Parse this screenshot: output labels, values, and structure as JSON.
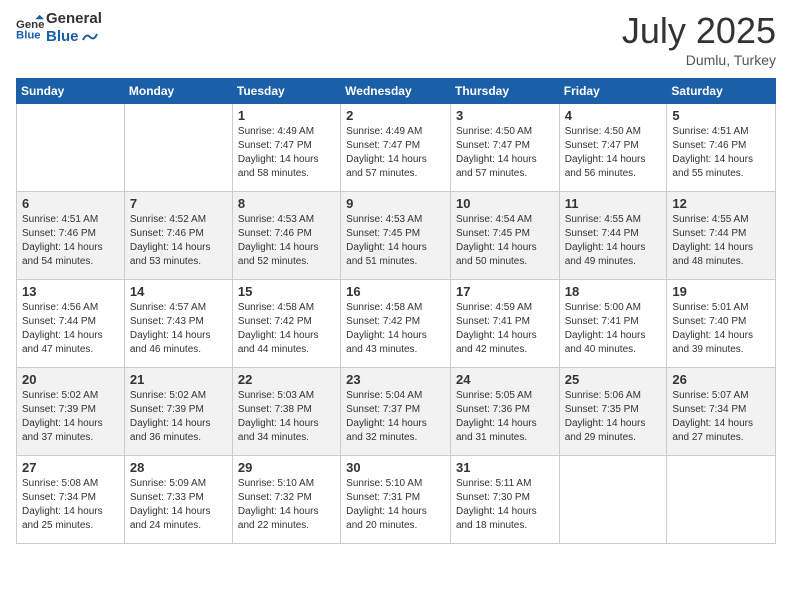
{
  "logo": {
    "text_general": "General",
    "text_blue": "Blue"
  },
  "header": {
    "month": "July 2025",
    "location": "Dumlu, Turkey"
  },
  "weekdays": [
    "Sunday",
    "Monday",
    "Tuesday",
    "Wednesday",
    "Thursday",
    "Friday",
    "Saturday"
  ],
  "weeks": [
    [
      {
        "day": "",
        "sunrise": "",
        "sunset": "",
        "daylight": ""
      },
      {
        "day": "",
        "sunrise": "",
        "sunset": "",
        "daylight": ""
      },
      {
        "day": "1",
        "sunrise": "Sunrise: 4:49 AM",
        "sunset": "Sunset: 7:47 PM",
        "daylight": "Daylight: 14 hours and 58 minutes."
      },
      {
        "day": "2",
        "sunrise": "Sunrise: 4:49 AM",
        "sunset": "Sunset: 7:47 PM",
        "daylight": "Daylight: 14 hours and 57 minutes."
      },
      {
        "day": "3",
        "sunrise": "Sunrise: 4:50 AM",
        "sunset": "Sunset: 7:47 PM",
        "daylight": "Daylight: 14 hours and 57 minutes."
      },
      {
        "day": "4",
        "sunrise": "Sunrise: 4:50 AM",
        "sunset": "Sunset: 7:47 PM",
        "daylight": "Daylight: 14 hours and 56 minutes."
      },
      {
        "day": "5",
        "sunrise": "Sunrise: 4:51 AM",
        "sunset": "Sunset: 7:46 PM",
        "daylight": "Daylight: 14 hours and 55 minutes."
      }
    ],
    [
      {
        "day": "6",
        "sunrise": "Sunrise: 4:51 AM",
        "sunset": "Sunset: 7:46 PM",
        "daylight": "Daylight: 14 hours and 54 minutes."
      },
      {
        "day": "7",
        "sunrise": "Sunrise: 4:52 AM",
        "sunset": "Sunset: 7:46 PM",
        "daylight": "Daylight: 14 hours and 53 minutes."
      },
      {
        "day": "8",
        "sunrise": "Sunrise: 4:53 AM",
        "sunset": "Sunset: 7:46 PM",
        "daylight": "Daylight: 14 hours and 52 minutes."
      },
      {
        "day": "9",
        "sunrise": "Sunrise: 4:53 AM",
        "sunset": "Sunset: 7:45 PM",
        "daylight": "Daylight: 14 hours and 51 minutes."
      },
      {
        "day": "10",
        "sunrise": "Sunrise: 4:54 AM",
        "sunset": "Sunset: 7:45 PM",
        "daylight": "Daylight: 14 hours and 50 minutes."
      },
      {
        "day": "11",
        "sunrise": "Sunrise: 4:55 AM",
        "sunset": "Sunset: 7:44 PM",
        "daylight": "Daylight: 14 hours and 49 minutes."
      },
      {
        "day": "12",
        "sunrise": "Sunrise: 4:55 AM",
        "sunset": "Sunset: 7:44 PM",
        "daylight": "Daylight: 14 hours and 48 minutes."
      }
    ],
    [
      {
        "day": "13",
        "sunrise": "Sunrise: 4:56 AM",
        "sunset": "Sunset: 7:44 PM",
        "daylight": "Daylight: 14 hours and 47 minutes."
      },
      {
        "day": "14",
        "sunrise": "Sunrise: 4:57 AM",
        "sunset": "Sunset: 7:43 PM",
        "daylight": "Daylight: 14 hours and 46 minutes."
      },
      {
        "day": "15",
        "sunrise": "Sunrise: 4:58 AM",
        "sunset": "Sunset: 7:42 PM",
        "daylight": "Daylight: 14 hours and 44 minutes."
      },
      {
        "day": "16",
        "sunrise": "Sunrise: 4:58 AM",
        "sunset": "Sunset: 7:42 PM",
        "daylight": "Daylight: 14 hours and 43 minutes."
      },
      {
        "day": "17",
        "sunrise": "Sunrise: 4:59 AM",
        "sunset": "Sunset: 7:41 PM",
        "daylight": "Daylight: 14 hours and 42 minutes."
      },
      {
        "day": "18",
        "sunrise": "Sunrise: 5:00 AM",
        "sunset": "Sunset: 7:41 PM",
        "daylight": "Daylight: 14 hours and 40 minutes."
      },
      {
        "day": "19",
        "sunrise": "Sunrise: 5:01 AM",
        "sunset": "Sunset: 7:40 PM",
        "daylight": "Daylight: 14 hours and 39 minutes."
      }
    ],
    [
      {
        "day": "20",
        "sunrise": "Sunrise: 5:02 AM",
        "sunset": "Sunset: 7:39 PM",
        "daylight": "Daylight: 14 hours and 37 minutes."
      },
      {
        "day": "21",
        "sunrise": "Sunrise: 5:02 AM",
        "sunset": "Sunset: 7:39 PM",
        "daylight": "Daylight: 14 hours and 36 minutes."
      },
      {
        "day": "22",
        "sunrise": "Sunrise: 5:03 AM",
        "sunset": "Sunset: 7:38 PM",
        "daylight": "Daylight: 14 hours and 34 minutes."
      },
      {
        "day": "23",
        "sunrise": "Sunrise: 5:04 AM",
        "sunset": "Sunset: 7:37 PM",
        "daylight": "Daylight: 14 hours and 32 minutes."
      },
      {
        "day": "24",
        "sunrise": "Sunrise: 5:05 AM",
        "sunset": "Sunset: 7:36 PM",
        "daylight": "Daylight: 14 hours and 31 minutes."
      },
      {
        "day": "25",
        "sunrise": "Sunrise: 5:06 AM",
        "sunset": "Sunset: 7:35 PM",
        "daylight": "Daylight: 14 hours and 29 minutes."
      },
      {
        "day": "26",
        "sunrise": "Sunrise: 5:07 AM",
        "sunset": "Sunset: 7:34 PM",
        "daylight": "Daylight: 14 hours and 27 minutes."
      }
    ],
    [
      {
        "day": "27",
        "sunrise": "Sunrise: 5:08 AM",
        "sunset": "Sunset: 7:34 PM",
        "daylight": "Daylight: 14 hours and 25 minutes."
      },
      {
        "day": "28",
        "sunrise": "Sunrise: 5:09 AM",
        "sunset": "Sunset: 7:33 PM",
        "daylight": "Daylight: 14 hours and 24 minutes."
      },
      {
        "day": "29",
        "sunrise": "Sunrise: 5:10 AM",
        "sunset": "Sunset: 7:32 PM",
        "daylight": "Daylight: 14 hours and 22 minutes."
      },
      {
        "day": "30",
        "sunrise": "Sunrise: 5:10 AM",
        "sunset": "Sunset: 7:31 PM",
        "daylight": "Daylight: 14 hours and 20 minutes."
      },
      {
        "day": "31",
        "sunrise": "Sunrise: 5:11 AM",
        "sunset": "Sunset: 7:30 PM",
        "daylight": "Daylight: 14 hours and 18 minutes."
      },
      {
        "day": "",
        "sunrise": "",
        "sunset": "",
        "daylight": ""
      },
      {
        "day": "",
        "sunrise": "",
        "sunset": "",
        "daylight": ""
      }
    ]
  ]
}
